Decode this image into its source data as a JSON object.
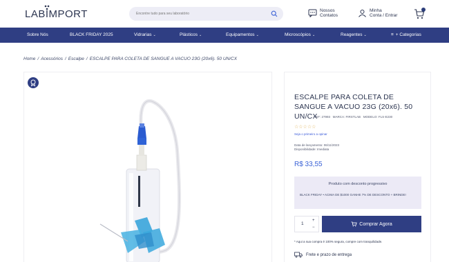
{
  "header": {
    "logo": "LABIMPORT",
    "search_placeholder": "Encontre tudo para seu laboratório",
    "contact_line1": "Nossos",
    "contact_line2": "Contatos",
    "account_line1": "Minha",
    "account_line2": "Conta / Entrar"
  },
  "nav": {
    "items": [
      {
        "label": "Sobre Nós",
        "chevron": false
      },
      {
        "label": "BLACK FRIDAY 2025",
        "chevron": false
      },
      {
        "label": "Vidrarias",
        "chevron": true
      },
      {
        "label": "Plásticos",
        "chevron": true
      },
      {
        "label": "Equipamentos",
        "chevron": true
      },
      {
        "label": "Microscópios",
        "chevron": true
      },
      {
        "label": "Reagentes",
        "chevron": true
      },
      {
        "label": "+ Categorias",
        "chevron": false
      }
    ]
  },
  "breadcrumb": {
    "items": [
      "Home",
      "Acessórios",
      "Escalpe",
      "ESCALPE PARA COLETA DE SANGUE A VACUO 23G (20x6). 50 UN/CX"
    ]
  },
  "product": {
    "title": "ESCALPE PARA COLETA DE SANGUE A VACUO 23G (20x6). 50 UN/CX",
    "ref": "REF: 27993",
    "brand": "MARCA: FIRSTLAB",
    "model": "MODELO: FLS-E230",
    "stars": "☆☆☆☆☆",
    "review_link": "Seja o primeiro a opinar",
    "launch_date": "Data de lançamento: 06/11/2023",
    "availability": "Disponibilidade: Imediata",
    "price": "R$ 33,55",
    "promo_title": "Produto com desconto progressivo",
    "promo_text": "BLACK FRIDAY • ACIMA DE $1000 GANHE 7% DE DESCONTO + BRINDE!",
    "quantity": "1",
    "qty_plus": "+",
    "qty_minus": "−",
    "buy_label": "Comprar Agora",
    "secure_text": "* Aqui a sua compra é 100% segura, compre com tranquilidade.",
    "shipping_text": "Frete e prazo de entrega"
  },
  "colors": {
    "brand": "#2f3e83",
    "price": "#3b62d6",
    "promo_bg": "#eceaf6"
  }
}
